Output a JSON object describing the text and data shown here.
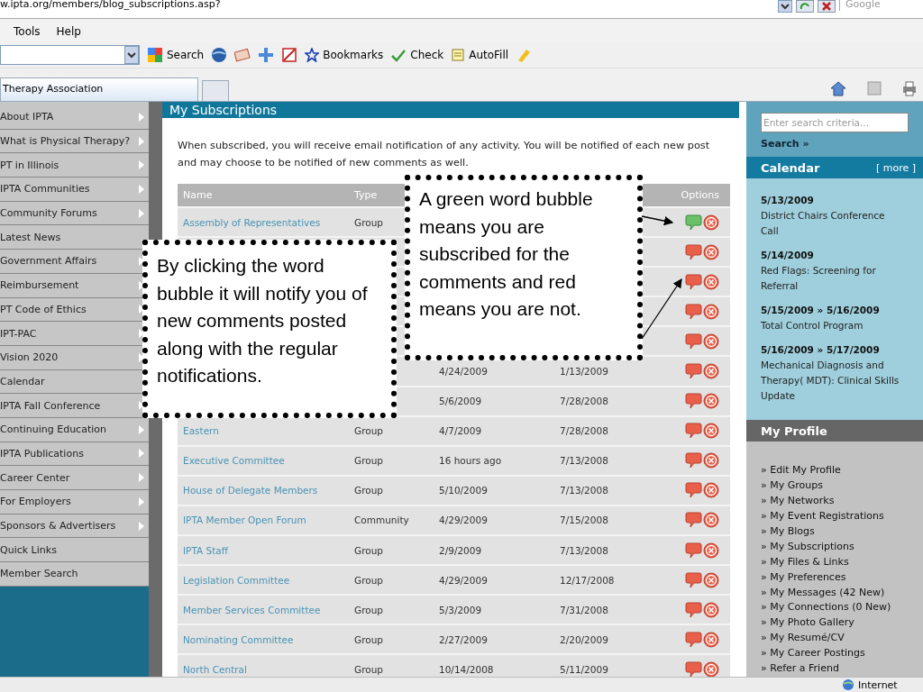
{
  "browser": {
    "address": "w.ipta.org/members/blog_subscriptions.asp?",
    "search_placeholder": "Google",
    "menu": [
      "Tools",
      "Help"
    ],
    "toolbar": [
      {
        "label": "Search",
        "kind": "search"
      },
      {
        "label": "Bookmarks",
        "kind": "star"
      },
      {
        "label": "Check",
        "kind": "check"
      },
      {
        "label": "AutoFill",
        "kind": "autofill"
      }
    ],
    "tab": "Therapy Association"
  },
  "nav": [
    {
      "label": "About IPTA",
      "has_submenu": true
    },
    {
      "label": "What is Physical Therapy?",
      "has_submenu": true
    },
    {
      "label": "PT in Illinois",
      "has_submenu": true
    },
    {
      "label": "IPTA Communities",
      "has_submenu": true
    },
    {
      "label": "Community Forums",
      "has_submenu": true
    },
    {
      "label": "Latest News",
      "has_submenu": false
    },
    {
      "label": "Government Affairs",
      "has_submenu": true
    },
    {
      "label": "Reimbursement",
      "has_submenu": true
    },
    {
      "label": "PT Code of Ethics",
      "has_submenu": true
    },
    {
      "label": "IPT-PAC",
      "has_submenu": true
    },
    {
      "label": "Vision 2020",
      "has_submenu": true
    },
    {
      "label": "Calendar",
      "has_submenu": false
    },
    {
      "label": "IPTA Fall Conference",
      "has_submenu": true
    },
    {
      "label": "Continuing Education",
      "has_submenu": true
    },
    {
      "label": "IPTA Publications",
      "has_submenu": true
    },
    {
      "label": "Career Center",
      "has_submenu": true
    },
    {
      "label": "For Employers",
      "has_submenu": true
    },
    {
      "label": "Sponsors & Advertisers",
      "has_submenu": true
    },
    {
      "label": "Quick Links",
      "has_submenu": false
    },
    {
      "label": "Member Search",
      "has_submenu": false
    }
  ],
  "page_title": "My Subscriptions",
  "intro": "When subscribed, you will receive email notification of any activity. You will be notified of each new post and may choose to be notified of new comments as well.",
  "table": {
    "columns": [
      "Name",
      "Type",
      "",
      "",
      "Options"
    ],
    "rows": [
      {
        "name": "Assembly of Representatives",
        "type": "Group",
        "subscribed": true
      },
      {
        "subscribed": false
      },
      {
        "subscribed": false
      },
      {
        "subscribed": false
      },
      {
        "subscribed": false
      },
      {
        "column_3": "4/24/2009",
        "column_4": "1/13/2009",
        "subscribed": false
      },
      {
        "column_3": "5/6/2009",
        "column_4": "7/28/2008",
        "subscribed": false
      },
      {
        "name": "Eastern",
        "type": "Group",
        "column_3": "4/7/2009",
        "column_4": "7/28/2008",
        "subscribed": false
      },
      {
        "name": "Executive Committee",
        "type": "Group",
        "column_3": "16 hours ago",
        "column_4": "7/13/2008",
        "subscribed": false
      },
      {
        "name": "House of Delegate Members",
        "type": "Group",
        "column_3": "5/10/2009",
        "column_4": "7/13/2008",
        "subscribed": false
      },
      {
        "name": "IPTA Member Open Forum",
        "type": "Community",
        "column_3": "4/29/2009",
        "column_4": "7/15/2008",
        "subscribed": false
      },
      {
        "name": "IPTA Staff",
        "type": "Group",
        "column_3": "2/9/2009",
        "column_4": "7/13/2008",
        "subscribed": false
      },
      {
        "name": "Legislation Committee",
        "type": "Group",
        "column_3": "4/29/2009",
        "column_4": "12/17/2008",
        "subscribed": false
      },
      {
        "name": "Member Services Committee",
        "type": "Group",
        "column_3": "5/3/2009",
        "column_4": "7/31/2008",
        "subscribed": false
      },
      {
        "name": "Nominating Committee",
        "type": "Group",
        "column_3": "2/27/2009",
        "column_4": "2/20/2009",
        "subscribed": false
      },
      {
        "name": "North Central",
        "type": "Group",
        "column_3": "10/14/2008",
        "column_4": "5/11/2009",
        "subscribed": false
      }
    ]
  },
  "callouts": [
    "By clicking the word bubble it will notify you of new comments posted along with the regular notifications.",
    "A green word bubble means you are subscribed for the comments and red means you are not."
  ],
  "sidebar": {
    "search_placeholder": "Enter search criteria...",
    "search_link": "Search »",
    "calendar_title": "Calendar",
    "more": "[ more ]",
    "events": [
      {
        "date": "5/13/2009",
        "title": "District Chairs Conference Call"
      },
      {
        "date": "5/14/2009",
        "title": "Red Flags: Screening for Referral"
      },
      {
        "date": "5/15/2009 » 5/16/2009",
        "title": "Total Control Program"
      },
      {
        "date": "5/16/2009 » 5/17/2009",
        "title": "Mechanical Diagnosis and Therapy( MDT): Clinical Skills Update"
      }
    ],
    "profile_title": "My Profile",
    "profile_links": [
      "» Edit My Profile",
      "» My Groups",
      "» My Networks",
      "» My Event Registrations",
      "» My Blogs",
      "» My Subscriptions",
      "» My Files & Links",
      "» My Preferences",
      "» My Messages (42 New)",
      "» My Connections (0 New)",
      "» My Photo Gallery",
      "» My Resumé/CV",
      "» My Career Postings",
      "» Refer a Friend"
    ]
  },
  "status_bar": {
    "zone": "Internet"
  }
}
